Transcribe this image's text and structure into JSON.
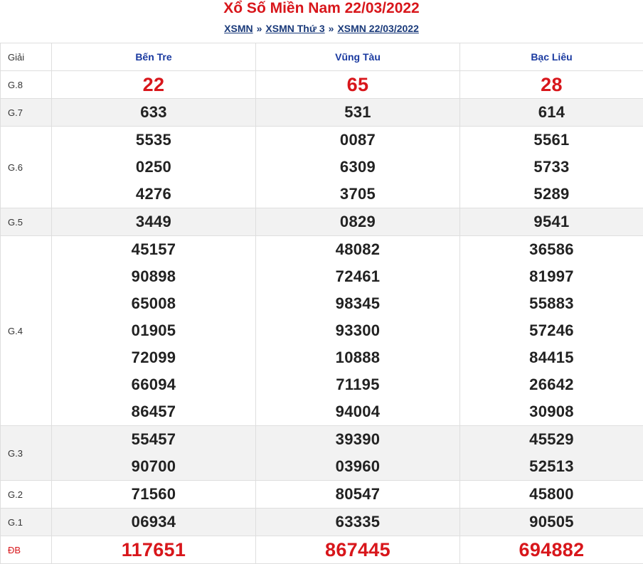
{
  "title": "Xổ Số Miền Nam 22/03/2022",
  "breadcrumb": {
    "items": [
      "XSMN",
      "XSMN Thứ 3",
      "XSMN 22/03/2022"
    ],
    "separator": "»"
  },
  "table": {
    "label_header": "Giải",
    "provinces": [
      "Bến Tre",
      "Vũng Tàu",
      "Bạc Liêu"
    ],
    "rows": [
      {
        "label": "G.8",
        "values": [
          [
            "22"
          ],
          [
            "65"
          ],
          [
            "28"
          ]
        ]
      },
      {
        "label": "G.7",
        "values": [
          [
            "633"
          ],
          [
            "531"
          ],
          [
            "614"
          ]
        ]
      },
      {
        "label": "G.6",
        "values": [
          [
            "5535",
            "0250",
            "4276"
          ],
          [
            "0087",
            "6309",
            "3705"
          ],
          [
            "5561",
            "5733",
            "5289"
          ]
        ]
      },
      {
        "label": "G.5",
        "values": [
          [
            "3449"
          ],
          [
            "0829"
          ],
          [
            "9541"
          ]
        ]
      },
      {
        "label": "G.4",
        "values": [
          [
            "45157",
            "90898",
            "65008",
            "01905",
            "72099",
            "66094",
            "86457"
          ],
          [
            "48082",
            "72461",
            "98345",
            "93300",
            "10888",
            "71195",
            "94004"
          ],
          [
            "36586",
            "81997",
            "55883",
            "57246",
            "84415",
            "26642",
            "30908"
          ]
        ]
      },
      {
        "label": "G.3",
        "values": [
          [
            "55457",
            "90700"
          ],
          [
            "39390",
            "03960"
          ],
          [
            "45529",
            "52513"
          ]
        ]
      },
      {
        "label": "G.2",
        "values": [
          [
            "71560"
          ],
          [
            "80547"
          ],
          [
            "45800"
          ]
        ]
      },
      {
        "label": "G.1",
        "values": [
          [
            "06934"
          ],
          [
            "63335"
          ],
          [
            "90505"
          ]
        ]
      },
      {
        "label": "ĐB",
        "values": [
          [
            "117651"
          ],
          [
            "867445"
          ],
          [
            "694882"
          ]
        ]
      }
    ]
  },
  "colors": {
    "accent_red": "#d8161b",
    "header_blue": "#1a3aa0",
    "link_blue": "#1a3a7a"
  }
}
